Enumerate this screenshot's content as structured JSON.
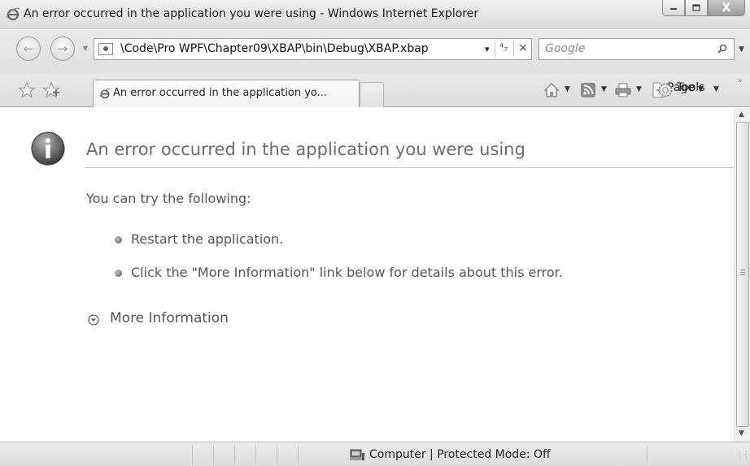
{
  "window": {
    "title": "An error occurred in the application you were using - Windows Internet Explorer",
    "minimize_icon": "minimize-icon",
    "maximize_icon": "maximize-icon",
    "close_glyph": "X"
  },
  "navigation": {
    "back_icon": "back-arrow-icon",
    "forward_icon": "forward-arrow-icon"
  },
  "address_bar": {
    "url": "\\Code\\Pro WPF\\Chapter09\\XBAP\\bin\\Debug\\XBAP.xbap",
    "refresh_glyph": "⁴₇",
    "stop_glyph": "×",
    "dropdown_glyph": "▾"
  },
  "search": {
    "placeholder": "Google"
  },
  "tabs": [
    {
      "label": "An error occurred in the application yo..."
    }
  ],
  "toolbar": {
    "page_label": "Page",
    "tools_label": "Tools",
    "more_glyph": "»"
  },
  "error_page": {
    "title": "An error occurred in the application you were using",
    "intro": "You can try the following:",
    "suggestions": [
      "Restart the application.",
      "Click the \"More Information\" link below for details about this error."
    ],
    "more_info_label": "More Information"
  },
  "status_bar": {
    "zone_text": "Computer | Protected Mode: Off"
  },
  "colors": {
    "chrome": "#e3e3e3",
    "title_text": "#6d6d6d",
    "body_text": "#555555"
  }
}
